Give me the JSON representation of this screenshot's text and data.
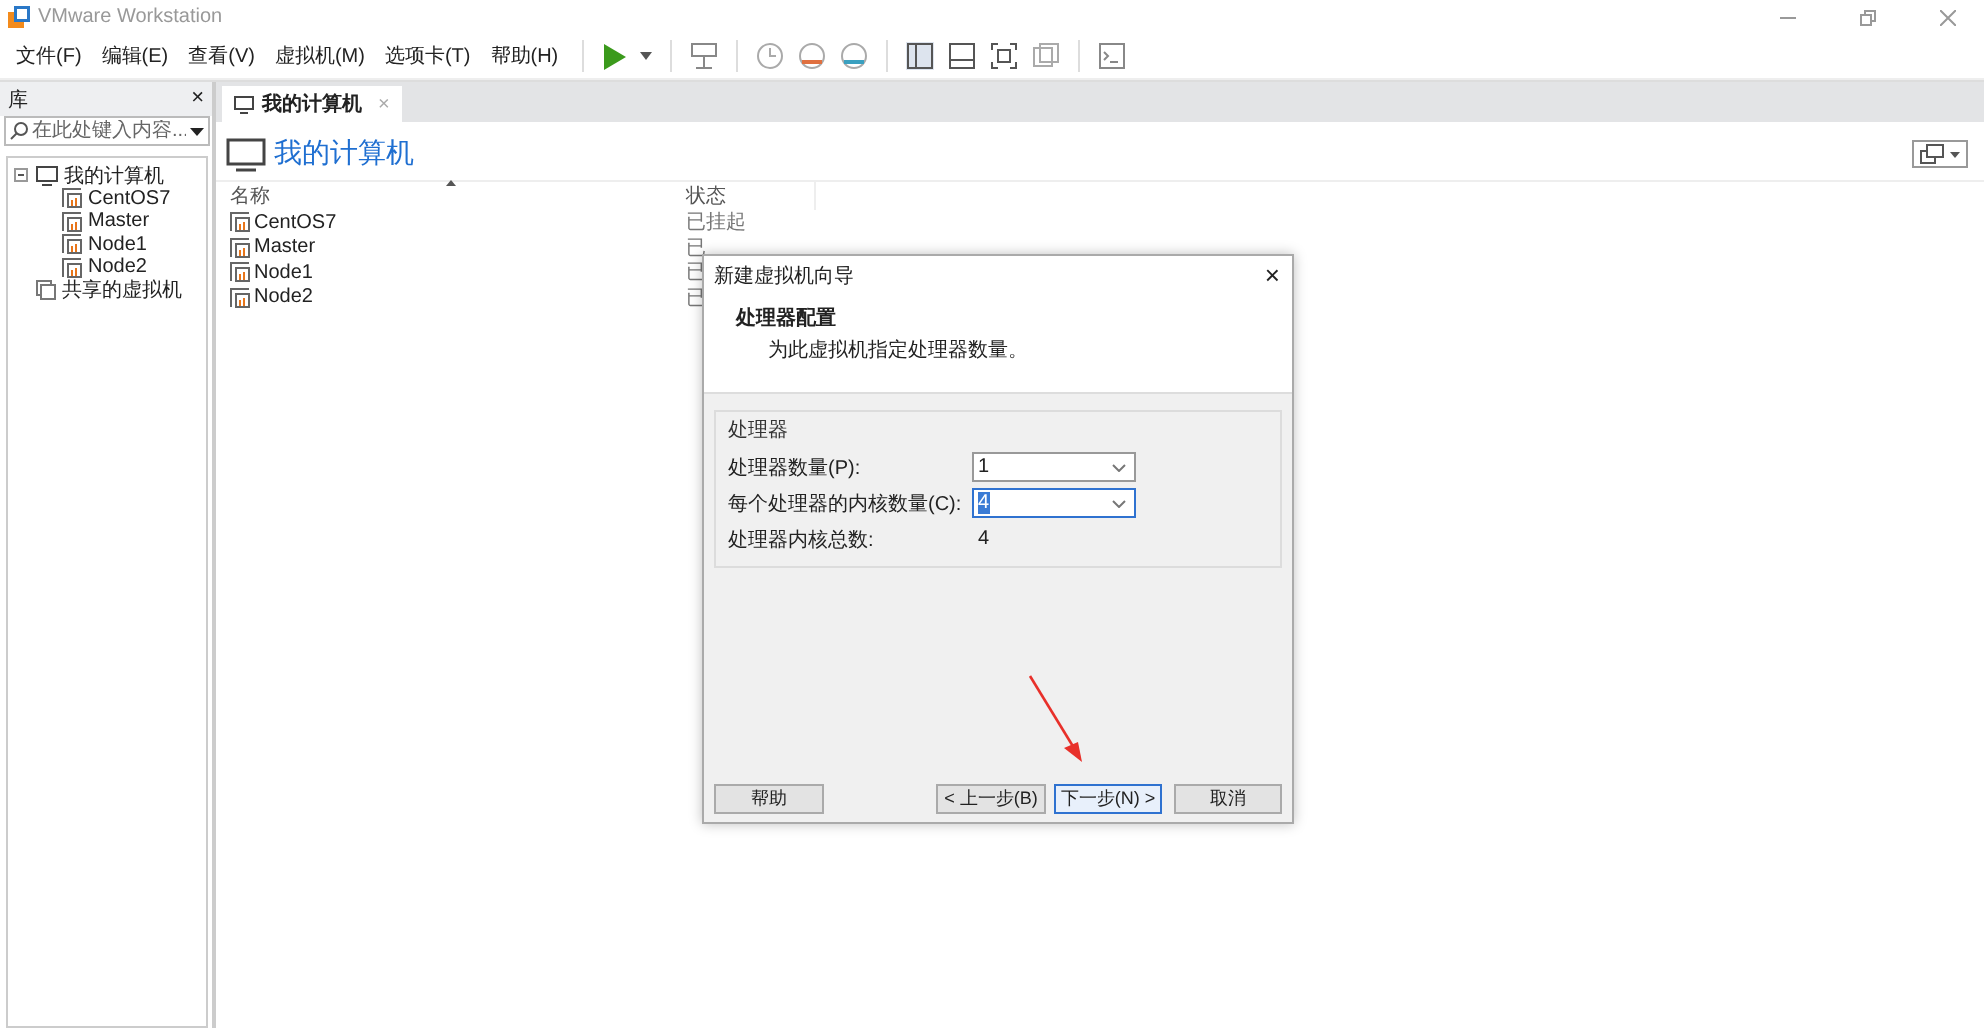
{
  "window": {
    "title": "VMware Workstation"
  },
  "menu": [
    "文件(F)",
    "编辑(E)",
    "查看(V)",
    "虚拟机(M)",
    "选项卡(T)",
    "帮助(H)"
  ],
  "library": {
    "title": "库",
    "close": "×",
    "search": {
      "placeholder": "在此处键入内容..."
    },
    "tree": [
      {
        "label": "我的计算机",
        "kind": "computer",
        "expanded": true,
        "children": [
          {
            "label": "CentOS7",
            "kind": "vm"
          },
          {
            "label": "Master",
            "kind": "vm"
          },
          {
            "label": "Node1",
            "kind": "vm"
          },
          {
            "label": "Node2",
            "kind": "vm"
          }
        ]
      },
      {
        "label": "共享的虚拟机",
        "kind": "shared"
      }
    ]
  },
  "tabs": [
    {
      "label": "我的计算机",
      "selected": true,
      "close": "×"
    }
  ],
  "page": {
    "title": "我的计算机",
    "columns": [
      "名称",
      "状态"
    ],
    "rows": [
      {
        "name": "CentOS7",
        "status": "已挂起"
      },
      {
        "name": "Master",
        "status": "已"
      },
      {
        "name": "Node1",
        "status": "已"
      },
      {
        "name": "Node2",
        "status": "已"
      }
    ]
  },
  "dialog": {
    "title": "新建虚拟机向导",
    "close": "×",
    "heading": "处理器配置",
    "subtitle": "为此虚拟机指定处理器数量。",
    "group": "处理器",
    "fields": [
      {
        "label": "处理器数量(P):",
        "value": "1",
        "focused": false
      },
      {
        "label": "每个处理器的内核数量(C):",
        "value": "4",
        "focused": true
      }
    ],
    "total": {
      "label": "处理器内核总数:",
      "value": "4"
    },
    "buttons": [
      {
        "label": "帮助",
        "default": false
      },
      {
        "label": "< 上一步(B)",
        "default": false
      },
      {
        "label": "下一步(N) >",
        "default": true
      },
      {
        "label": "取消",
        "default": false
      }
    ]
  }
}
